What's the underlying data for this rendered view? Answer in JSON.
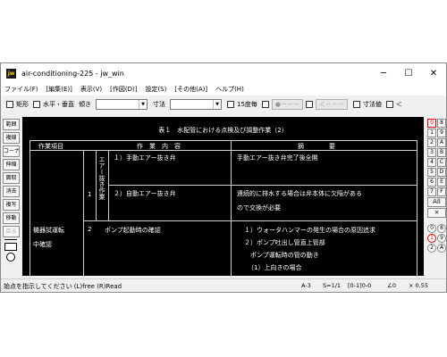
{
  "window": {
    "title": "air-conditioning-225 - jw_win",
    "app_icon": "jw",
    "minimize": "─",
    "maximize": "☐",
    "close": "✕"
  },
  "menu": [
    "ファイル(F)",
    "[編集(E)]",
    "表示(V)",
    "[作図(D)]",
    "設定(S)",
    "[その他(A)]",
    "ヘルプ(H)"
  ],
  "toolbar": {
    "rect_label": "矩形",
    "horiz_vert_label": "水平・垂直",
    "slope_label": "傾き",
    "dim_label": "寸法",
    "deg15_label": "15度毎",
    "circle_btn": "●－－－",
    "arrow_btn": "＜－－－",
    "dimval_label": "寸法値",
    "lt_label": "＜"
  },
  "left_buttons": [
    "範囲",
    "複線",
    "コーナー",
    "伸縮",
    "面取",
    "消去",
    "複写",
    "移動",
    "戻る"
  ],
  "right_buttons": {
    "rows": [
      [
        "0",
        "8"
      ],
      [
        "1",
        "9"
      ],
      [
        "2",
        "A"
      ],
      [
        "3",
        "B"
      ],
      [
        "4",
        "C"
      ],
      [
        "5",
        "D"
      ],
      [
        "6",
        "E"
      ],
      [
        "7",
        "F"
      ]
    ],
    "all": "All",
    "x": "×",
    "circles": [
      [
        "0",
        "8"
      ],
      [
        "1",
        "9"
      ],
      [
        "2",
        "A"
      ]
    ]
  },
  "drawing": {
    "title": "表１　水配管における点検及び調整作業（2）",
    "headers": {
      "item": "作業項目",
      "content": "作　業　内　容",
      "summary": "摘　　　　要"
    },
    "vertical_label": "エアー抜き作業",
    "item_label_1": "機器試運転",
    "item_label_2": "中確認",
    "row1_num": "1",
    "row2_num": "2",
    "cells": {
      "r1a": "１）手動エアー抜き弁",
      "r1a_note": "手動エアー抜き弁完了後全開",
      "r1b": "２）自動エアー抜き弁",
      "r1b_note1": "連続的に排水する場合は弁本体に欠陥がある",
      "r1b_note2": "ので交換が必要",
      "r2": "ポンプ起動時の確認",
      "r2_note1": "１）ウォータハンマーの発生の場合の原因追求",
      "r2_note2": "２）ポンプ吐出し管直上管部",
      "r2_note3": "　ポンプ運転時の管の動き",
      "r2_note4": "（1）上向きの場合"
    }
  },
  "status": {
    "message": "始点を指示してください (L)free (R)Read",
    "paper": "A-3",
    "scale": "S=1/1",
    "layer": "[0-1]0-0",
    "angle": "∠0",
    "zoom": "× 0.55"
  }
}
